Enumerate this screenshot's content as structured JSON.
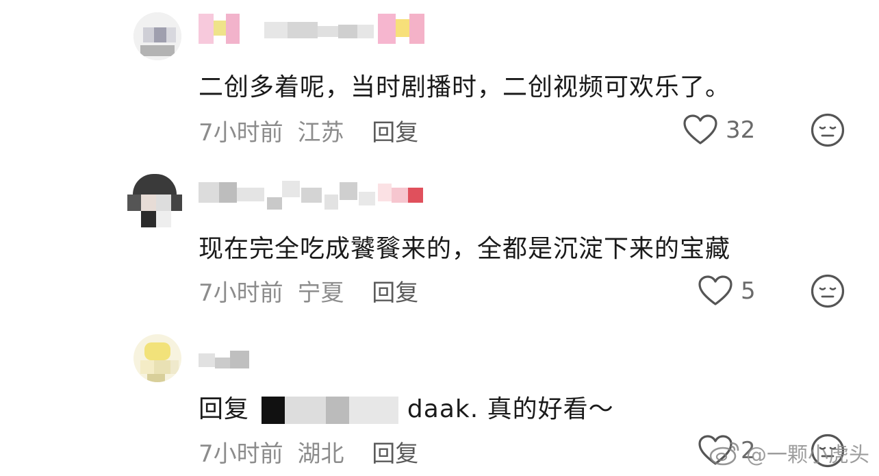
{
  "comments": [
    {
      "content": "二创多着呢，当时剧播时，二创视频可欢乐了。",
      "time": "7小时前",
      "location": "江苏",
      "reply_label": "回复",
      "likes": "32"
    },
    {
      "content": "现在完全吃成饕餮来的，全都是沉淀下来的宝藏",
      "time": "7小时前",
      "location": "宁夏",
      "reply_label": "回复",
      "likes": "5"
    },
    {
      "content_prefix": "回复",
      "content_visible": "daak. 真的好看～",
      "time": "7小时前",
      "location": "湖北",
      "reply_label": "回复",
      "likes": "2"
    }
  ],
  "watermark": {
    "text": "@一颗小虎头"
  },
  "colors": {
    "text": "#1a1a1a",
    "meta": "#8c8c8c",
    "icon": "#555555"
  }
}
